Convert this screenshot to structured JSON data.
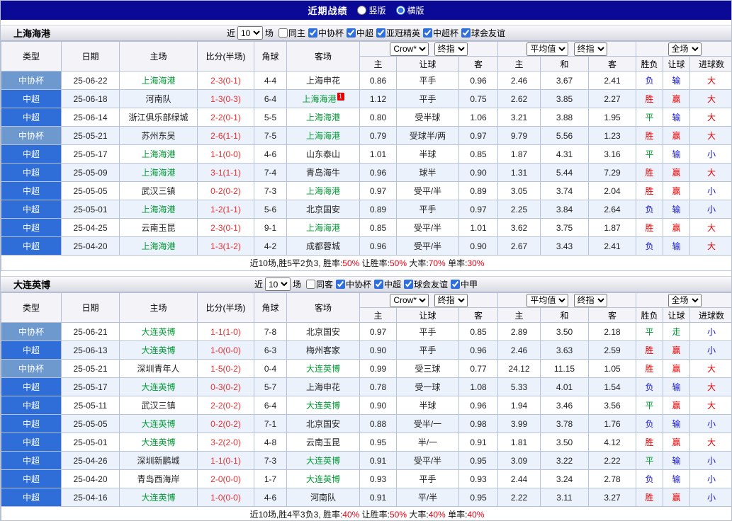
{
  "topbar": {
    "title": "近期战绩",
    "radios": [
      {
        "label": "竖版",
        "checked": false
      },
      {
        "label": "横版",
        "checked": true
      }
    ]
  },
  "table_headers": {
    "static": [
      "类型",
      "日期",
      "主场",
      "比分(半场)",
      "角球",
      "客场"
    ],
    "sub": [
      "主",
      "让球",
      "客",
      "主",
      "和",
      "客",
      "胜负",
      "让球",
      "进球数"
    ],
    "selects": {
      "bookmaker": "Crow*",
      "final_a": "终指",
      "average": "平均值",
      "final_b": "终指",
      "scope": "全场"
    }
  },
  "colors": {
    "topbar": "#0a0a96",
    "super_league": "#2f6ed9",
    "cup": "#6d99cf",
    "win_red": "#e60000",
    "draw_green": "#009933",
    "loss_blue": "#1515e0"
  },
  "sections": [
    {
      "team": "上海海港",
      "filter": {
        "near_label": "近",
        "count": "10",
        "games_label": "场",
        "checkboxes": [
          {
            "label": "同主",
            "checked": false
          },
          {
            "label": "中协杯",
            "checked": true
          },
          {
            "label": "中超",
            "checked": true
          },
          {
            "label": "亚冠精英",
            "checked": true
          },
          {
            "label": "中超杯",
            "checked": true
          },
          {
            "label": "球会友谊",
            "checked": true
          }
        ]
      },
      "table": {
        "rows": [
          {
            "type": "中协杯",
            "date": "25-06-22",
            "home": "上海海港",
            "home_focal": true,
            "score": "2-3(0-1)",
            "corner": "4-4",
            "away": "上海申花",
            "odds": [
              "0.86",
              "平手",
              "0.96"
            ],
            "avg": [
              "2.46",
              "3.67",
              "2.41"
            ],
            "outcome": "负",
            "let": "输",
            "goal": "大"
          },
          {
            "type": "中超",
            "date": "25-06-18",
            "home": "河南队",
            "score": "1-3(0-3)",
            "corner": "6-4",
            "away": "上海海港",
            "away_focal": true,
            "away_badge": "1",
            "odds": [
              "1.12",
              "平手",
              "0.75"
            ],
            "avg": [
              "2.62",
              "3.85",
              "2.27"
            ],
            "outcome": "胜",
            "let": "赢",
            "goal": "大"
          },
          {
            "type": "中超",
            "date": "25-06-14",
            "home": "浙江俱乐部绿城",
            "score": "2-2(0-1)",
            "corner": "5-5",
            "away": "上海海港",
            "away_focal": true,
            "odds": [
              "0.80",
              "受半球",
              "1.06"
            ],
            "avg": [
              "3.21",
              "3.88",
              "1.95"
            ],
            "outcome": "平",
            "let": "输",
            "goal": "大"
          },
          {
            "type": "中协杯",
            "date": "25-05-21",
            "home": "苏州东吴",
            "score": "2-6(1-1)",
            "corner": "7-5",
            "away": "上海海港",
            "away_focal": true,
            "odds": [
              "0.79",
              "受球半/两",
              "0.97"
            ],
            "avg": [
              "9.79",
              "5.56",
              "1.23"
            ],
            "outcome": "胜",
            "let": "赢",
            "goal": "大"
          },
          {
            "type": "中超",
            "date": "25-05-17",
            "home": "上海海港",
            "home_focal": true,
            "score": "1-1(0-0)",
            "corner": "4-6",
            "away": "山东泰山",
            "odds": [
              "1.01",
              "半球",
              "0.85"
            ],
            "avg": [
              "1.87",
              "4.31",
              "3.16"
            ],
            "outcome": "平",
            "let": "输",
            "goal": "小"
          },
          {
            "type": "中超",
            "date": "25-05-09",
            "home": "上海海港",
            "home_focal": true,
            "score": "3-1(1-1)",
            "corner": "7-4",
            "away": "青岛海牛",
            "odds": [
              "0.96",
              "球半",
              "0.90"
            ],
            "avg": [
              "1.31",
              "5.44",
              "7.29"
            ],
            "outcome": "胜",
            "let": "赢",
            "goal": "大"
          },
          {
            "type": "中超",
            "date": "25-05-05",
            "home": "武汉三镇",
            "score": "0-2(0-2)",
            "corner": "7-3",
            "away": "上海海港",
            "away_focal": true,
            "odds": [
              "0.97",
              "受平/半",
              "0.89"
            ],
            "avg": [
              "3.05",
              "3.74",
              "2.04"
            ],
            "outcome": "胜",
            "let": "赢",
            "goal": "小"
          },
          {
            "type": "中超",
            "date": "25-05-01",
            "home": "上海海港",
            "home_focal": true,
            "score": "1-2(1-1)",
            "corner": "5-6",
            "away": "北京国安",
            "odds": [
              "0.89",
              "平手",
              "0.97"
            ],
            "avg": [
              "2.25",
              "3.84",
              "2.64"
            ],
            "outcome": "负",
            "let": "输",
            "goal": "小"
          },
          {
            "type": "中超",
            "date": "25-04-25",
            "home": "云南玉昆",
            "score": "2-3(0-1)",
            "corner": "9-1",
            "away": "上海海港",
            "away_focal": true,
            "odds": [
              "0.85",
              "受平/半",
              "1.01"
            ],
            "avg": [
              "3.62",
              "3.75",
              "1.87"
            ],
            "outcome": "胜",
            "let": "赢",
            "goal": "大"
          },
          {
            "type": "中超",
            "date": "25-04-20",
            "home": "上海海港",
            "home_focal": true,
            "score": "1-3(1-2)",
            "corner": "4-2",
            "away": "成都蓉城",
            "odds": [
              "0.96",
              "受平/半",
              "0.90"
            ],
            "avg": [
              "2.67",
              "3.43",
              "2.41"
            ],
            "outcome": "负",
            "let": "输",
            "goal": "大"
          }
        ],
        "summary": [
          {
            "t": "近10场,胜5平2负3, 胜率:",
            "r": false
          },
          {
            "t": "50%",
            "r": true
          },
          {
            "t": " 让胜率:",
            "r": false
          },
          {
            "t": "50%",
            "r": true
          },
          {
            "t": " 大率:",
            "r": false
          },
          {
            "t": "70%",
            "r": true
          },
          {
            "t": " 单率:",
            "r": false
          },
          {
            "t": "30%",
            "r": true
          }
        ]
      }
    },
    {
      "team": "大连英博",
      "filter": {
        "near_label": "近",
        "count": "10",
        "games_label": "场",
        "checkboxes": [
          {
            "label": "同客",
            "checked": false
          },
          {
            "label": "中协杯",
            "checked": true
          },
          {
            "label": "中超",
            "checked": true
          },
          {
            "label": "球会友谊",
            "checked": true
          },
          {
            "label": "中甲",
            "checked": true
          }
        ]
      },
      "table": {
        "rows": [
          {
            "type": "中协杯",
            "date": "25-06-21",
            "home": "大连英博",
            "home_focal": true,
            "score": "1-1(1-0)",
            "corner": "7-8",
            "away": "北京国安",
            "odds": [
              "0.97",
              "平手",
              "0.85"
            ],
            "avg": [
              "2.89",
              "3.50",
              "2.18"
            ],
            "outcome": "平",
            "let": "走",
            "goal": "小"
          },
          {
            "type": "中超",
            "date": "25-06-13",
            "home": "大连英博",
            "home_focal": true,
            "score": "1-0(0-0)",
            "corner": "6-3",
            "away": "梅州客家",
            "odds": [
              "0.90",
              "平手",
              "0.96"
            ],
            "avg": [
              "2.46",
              "3.63",
              "2.59"
            ],
            "outcome": "胜",
            "let": "赢",
            "goal": "小"
          },
          {
            "type": "中协杯",
            "date": "25-05-21",
            "home": "深圳青年人",
            "score": "1-5(0-2)",
            "corner": "0-4",
            "away": "大连英博",
            "away_focal": true,
            "odds": [
              "0.99",
              "受三球",
              "0.77"
            ],
            "avg": [
              "24.12",
              "11.15",
              "1.05"
            ],
            "outcome": "胜",
            "let": "赢",
            "goal": "大"
          },
          {
            "type": "中超",
            "date": "25-05-17",
            "home": "大连英博",
            "home_focal": true,
            "score": "0-3(0-2)",
            "corner": "5-7",
            "away": "上海申花",
            "odds": [
              "0.78",
              "受一球",
              "1.08"
            ],
            "avg": [
              "5.33",
              "4.01",
              "1.54"
            ],
            "outcome": "负",
            "let": "输",
            "goal": "大"
          },
          {
            "type": "中超",
            "date": "25-05-11",
            "home": "武汉三镇",
            "score": "2-2(0-2)",
            "corner": "6-4",
            "away": "大连英博",
            "away_focal": true,
            "odds": [
              "0.90",
              "半球",
              "0.96"
            ],
            "avg": [
              "1.94",
              "3.46",
              "3.56"
            ],
            "outcome": "平",
            "let": "赢",
            "goal": "大"
          },
          {
            "type": "中超",
            "date": "25-05-05",
            "home": "大连英博",
            "home_focal": true,
            "score": "0-2(0-2)",
            "corner": "7-1",
            "away": "北京国安",
            "odds": [
              "0.88",
              "受半/一",
              "0.98"
            ],
            "avg": [
              "3.99",
              "3.78",
              "1.76"
            ],
            "outcome": "负",
            "let": "输",
            "goal": "小"
          },
          {
            "type": "中超",
            "date": "25-05-01",
            "home": "大连英博",
            "home_focal": true,
            "score": "3-2(2-0)",
            "corner": "4-8",
            "away": "云南玉昆",
            "odds": [
              "0.95",
              "半/一",
              "0.91"
            ],
            "avg": [
              "1.81",
              "3.50",
              "4.12"
            ],
            "outcome": "胜",
            "let": "赢",
            "goal": "大"
          },
          {
            "type": "中超",
            "date": "25-04-26",
            "home": "深圳新鹏城",
            "score": "1-1(0-1)",
            "corner": "7-3",
            "away": "大连英博",
            "away_focal": true,
            "odds": [
              "0.91",
              "受平/半",
              "0.95"
            ],
            "avg": [
              "3.09",
              "3.22",
              "2.22"
            ],
            "outcome": "平",
            "let": "输",
            "goal": "小"
          },
          {
            "type": "中超",
            "date": "25-04-20",
            "home": "青岛西海岸",
            "score": "2-0(0-0)",
            "corner": "1-7",
            "away": "大连英博",
            "away_focal": true,
            "odds": [
              "0.93",
              "平手",
              "0.93"
            ],
            "avg": [
              "2.44",
              "3.24",
              "2.78"
            ],
            "outcome": "负",
            "let": "输",
            "goal": "小"
          },
          {
            "type": "中超",
            "date": "25-04-16",
            "home": "大连英博",
            "home_focal": true,
            "score": "1-0(0-0)",
            "corner": "4-6",
            "away": "河南队",
            "odds": [
              "0.91",
              "平/半",
              "0.95"
            ],
            "avg": [
              "2.22",
              "3.11",
              "3.27"
            ],
            "outcome": "胜",
            "let": "赢",
            "goal": "小"
          }
        ],
        "summary": [
          {
            "t": "近10场,胜4平3负3, 胜率:",
            "r": false
          },
          {
            "t": "40%",
            "r": true
          },
          {
            "t": " 让胜率:",
            "r": false
          },
          {
            "t": "50%",
            "r": true
          },
          {
            "t": " 大率:",
            "r": false
          },
          {
            "t": "40%",
            "r": true
          },
          {
            "t": " 单率:",
            "r": false
          },
          {
            "t": "40%",
            "r": true
          }
        ]
      }
    }
  ]
}
